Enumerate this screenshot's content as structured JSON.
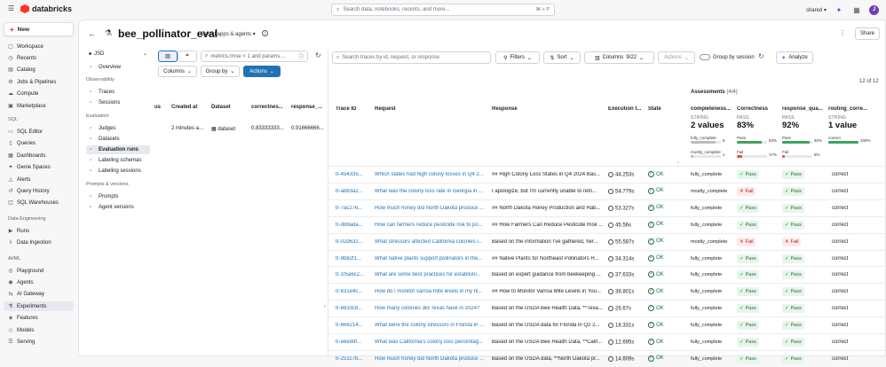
{
  "topbar": {
    "brand": "databricks",
    "search_placeholder": "Search data, notebooks, recents, and more...",
    "search_kbd": "⌘ + P",
    "workspace": "shared",
    "avatar": "J"
  },
  "sidebar": {
    "new_label": "New",
    "items": [
      {
        "label": "Workspace",
        "icon": "▢"
      },
      {
        "label": "Recents",
        "icon": "◷"
      },
      {
        "label": "Catalog",
        "icon": "▤"
      },
      {
        "label": "Jobs & Pipelines",
        "icon": "⚙"
      },
      {
        "label": "Compute",
        "icon": "☁"
      },
      {
        "label": "Marketplace",
        "icon": "▣"
      }
    ],
    "sql_head": "SQL",
    "sql_items": [
      {
        "label": "SQL Editor",
        "icon": "▭"
      },
      {
        "label": "Queries",
        "icon": "▯"
      },
      {
        "label": "Dashboards",
        "icon": "▦"
      },
      {
        "label": "Genie Spaces",
        "icon": "✦"
      },
      {
        "label": "Alerts",
        "icon": "△"
      },
      {
        "label": "Query History",
        "icon": "↺"
      },
      {
        "label": "SQL Warehouses",
        "icon": "◫"
      }
    ],
    "de_head": "Data Engineering",
    "de_items": [
      {
        "label": "Runs",
        "icon": "▶"
      },
      {
        "label": "Data Ingestion",
        "icon": "⇩"
      }
    ],
    "ml_head": "AI/ML",
    "ml_items": [
      {
        "label": "Playground",
        "icon": "◎"
      },
      {
        "label": "Agents",
        "icon": "◉"
      },
      {
        "label": "AI Gateway",
        "icon": "⇆"
      },
      {
        "label": "Experiments",
        "icon": "⚗"
      },
      {
        "label": "Features",
        "icon": "◈"
      },
      {
        "label": "Models",
        "icon": "◇"
      },
      {
        "label": "Serving",
        "icon": "☰"
      }
    ]
  },
  "header": {
    "title": "bee_pollinator_eval",
    "type_label": "GenAI apps & agents",
    "share_label": "Share"
  },
  "subnav": {
    "selector": "JSD",
    "items_top": [
      {
        "label": "Overview"
      }
    ],
    "obs_head": "Observability",
    "obs_items": [
      {
        "label": "Traces"
      },
      {
        "label": "Sessions"
      }
    ],
    "eval_head": "Evaluation",
    "eval_items": [
      {
        "label": "Judges"
      },
      {
        "label": "Datasets"
      },
      {
        "label": "Evaluation runs"
      },
      {
        "label": "Labeling schemas"
      },
      {
        "label": "Labeling sessions"
      }
    ],
    "pv_head": "Prompts & versions",
    "pv_items": [
      {
        "label": "Prompts"
      },
      {
        "label": "Agent versions"
      }
    ]
  },
  "runs_panel": {
    "search_placeholder": "metrics.rmse < 1 and params....",
    "columns_label": "Columns",
    "groupby_label": "Group by",
    "actions_label": "Actions",
    "headers": [
      "us",
      "Created at",
      "Dataset",
      "correctnes...",
      "response_..."
    ],
    "row": {
      "created": "2 minutes a...",
      "dataset": "dataset",
      "correctness": "0.83333333...",
      "response": "0.91666666..."
    }
  },
  "traces": {
    "search_placeholder": "Search traces by id, request, or response",
    "filters_label": "Filters",
    "sort_label": "Sort",
    "columns_label": "Columns",
    "columns_count": "9/22",
    "actions_label": "Actions",
    "groupby_session_label": "Group by session",
    "analyze_label": "Analyze",
    "count": "12 of 12",
    "assessments_title": "Assessments",
    "assessments_count": "(4/4)",
    "headers": [
      "Trace ID",
      "Request",
      "Response",
      "Execution t...",
      "State",
      "completeness...",
      "Correctness",
      "response_qua...",
      "routing_corre..."
    ],
    "summaries": {
      "completeness": {
        "label": "STRING",
        "value": "2 values",
        "rows": [
          {
            "name": "fully_complete",
            "count": "8",
            "frac": 0.83
          },
          {
            "name": "mostly_complete",
            "count": "1",
            "frac": 0.1
          }
        ]
      },
      "correctness": {
        "label": "PASS",
        "value": "83%",
        "rows": [
          {
            "name": "Pass",
            "count": "83%",
            "frac": 0.83
          },
          {
            "name": "Fail",
            "count": "17%",
            "frac": 0.17
          }
        ]
      },
      "response_quality": {
        "label": "PASS",
        "value": "92%",
        "rows": [
          {
            "name": "Pass",
            "count": "92%",
            "frac": 0.92
          },
          {
            "name": "Fail",
            "count": "8%",
            "frac": 0.08
          }
        ]
      },
      "routing": {
        "label": "STRING",
        "value": "1 value",
        "rows": [
          {
            "name": "correct",
            "count": "100%",
            "frac": 1.0
          }
        ]
      }
    },
    "rows": [
      {
        "id": "tr-454335...",
        "request": "Which states had high colony losses in Q4 2...",
        "response": "## High Colony Loss States in Q4 2024 Bas...",
        "time": "44.253s",
        "state": "OK",
        "completeness": "fully_complete",
        "correctness": "Pass",
        "quality": "Pass",
        "routing": "correct"
      },
      {
        "id": "tr-a883a2...",
        "request": "What was the colony loss rate in Georgia in ...",
        "response": "I apologize, but I'm currently unable to retri...",
        "time": "54.779s",
        "state": "OK",
        "completeness": "mostly_complete",
        "correctness": "Fail",
        "quality": "Pass",
        "routing": "correct"
      },
      {
        "id": "tr-7ac276...",
        "request": "How much honey did North Dakota produce ...",
        "response": "## North Dakota Honey Production and Hab...",
        "time": "53.327s",
        "state": "OK",
        "completeness": "fully_complete",
        "correctness": "Pass",
        "quality": "Pass",
        "routing": "correct"
      },
      {
        "id": "tr-d88ada...",
        "request": "How can farmers reduce pesticide risk to po...",
        "response": "## How Farmers Can Reduce Pesticide Risk ...",
        "time": "45.56s",
        "state": "OK",
        "completeness": "fully_complete",
        "correctness": "Pass",
        "quality": "Pass",
        "routing": "correct"
      },
      {
        "id": "tr-02d632...",
        "request": "What stressors affected California colonies i...",
        "response": "Based on the information I've gathered, her...",
        "time": "55.587s",
        "state": "OK",
        "completeness": "mostly_complete",
        "correctness": "Fail",
        "quality": "Fail",
        "routing": "correct"
      },
      {
        "id": "tr-9b82f1...",
        "request": "What native plants support pollinators in the...",
        "response": "## Native Plants for Northeast Pollinators H...",
        "time": "34.314s",
        "state": "OK",
        "completeness": "fully_complete",
        "correctness": "Pass",
        "quality": "Pass",
        "routing": "correct"
      },
      {
        "id": "tr-1f5a6c2...",
        "request": "What are some best practices for establishi...",
        "response": "Based on expert guidance from beekeeping ...",
        "time": "37.633s",
        "state": "OK",
        "completeness": "fully_complete",
        "correctness": "Pass",
        "quality": "Pass",
        "routing": "correct"
      },
      {
        "id": "tr-631e4c...",
        "request": "How do I monitor varroa mite levels in my hi...",
        "response": "## How to Monitor Varroa Mite Levels in You...",
        "time": "38.801s",
        "state": "OK",
        "completeness": "fully_complete",
        "correctness": "Pass",
        "quality": "Pass",
        "routing": "correct"
      },
      {
        "id": "tr-6633c8...",
        "request": "How many colonies did Texas have in 2024?",
        "response": "Based on the USDA Bee Health Data, **Texa...",
        "time": "26.67s",
        "state": "OK",
        "completeness": "fully_complete",
        "correctness": "Pass",
        "quality": "Pass",
        "routing": "correct"
      },
      {
        "id": "tr-666214...",
        "request": "What were the colony stressors in Florida in ...",
        "response": "Based on the USDA data for Florida in Q2 2...",
        "time": "18.331s",
        "state": "OK",
        "completeness": "fully_complete",
        "correctness": "Pass",
        "quality": "Pass",
        "routing": "correct"
      },
      {
        "id": "tr-e6e9df...",
        "request": "What was California's colony loss percentag...",
        "response": "Based on the USDA Bee Health Data, **Calif...",
        "time": "12.695s",
        "state": "OK",
        "completeness": "fully_complete",
        "correctness": "Pass",
        "quality": "Pass",
        "routing": "correct"
      },
      {
        "id": "tr-251c7b...",
        "request": "How much honey did North Dakota produce ...",
        "response": "Based on the USDA data, **North Dakota pr...",
        "time": "14.609s",
        "state": "OK",
        "completeness": "fully_complete",
        "correctness": "Pass",
        "quality": "Pass",
        "routing": "correct"
      }
    ]
  }
}
